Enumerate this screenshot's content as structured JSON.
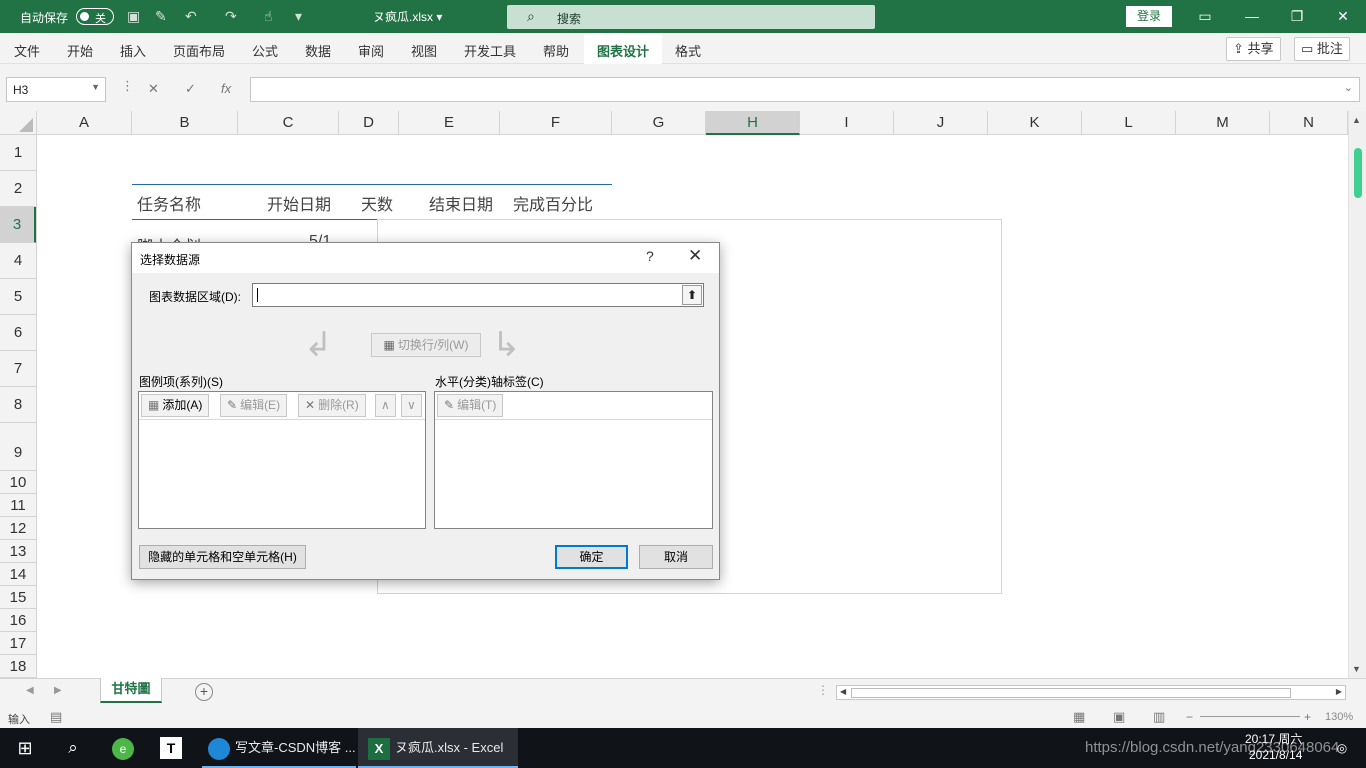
{
  "titlebar": {
    "autosave_label": "自动保存",
    "autosave_state": "关",
    "document_name": "ヌ疯瓜.xlsx",
    "search_placeholder": "搜索",
    "login_label": "登录"
  },
  "ribbon": {
    "tabs": [
      "文件",
      "开始",
      "插入",
      "页面布局",
      "公式",
      "数据",
      "审阅",
      "视图",
      "开发工具",
      "帮助",
      "图表设计",
      "格式"
    ],
    "active_tab": "图表设计",
    "share_label": "共享",
    "comments_label": "批注"
  },
  "formula_bar": {
    "name_box": "H3",
    "cancel_icon": "✕",
    "enter_icon": "✓",
    "fx_label": "fx",
    "formula": ""
  },
  "grid": {
    "columns": [
      "A",
      "B",
      "C",
      "D",
      "E",
      "F",
      "G",
      "H",
      "I",
      "J",
      "K",
      "L",
      "M",
      "N"
    ],
    "selected_column": "H",
    "rows": [
      "1",
      "2",
      "3",
      "4",
      "5",
      "6",
      "7",
      "8",
      "9",
      "10",
      "11",
      "12",
      "13",
      "14",
      "15",
      "16",
      "17",
      "18"
    ],
    "selected_row": "3",
    "header_row": {
      "task": "任务名称",
      "start": "开始日期",
      "days": "天数",
      "end": "结束日期",
      "percent": "完成百分比"
    },
    "row3_partial_b": "脚本企划",
    "row3_partial_c": "5/1"
  },
  "dialog": {
    "title": "选择数据源",
    "help": "?",
    "close": "✕",
    "chart_range_label": "图表数据区域(D):",
    "chart_range_value": "",
    "switch_button": "切换行/列(W)",
    "legend_label": "图例项(系列)(S)",
    "add_button": "添加(A)",
    "edit_button": "编辑(E)",
    "delete_button": "删除(R)",
    "axis_label": "水平(分类)轴标签(C)",
    "axis_edit_button": "编辑(T)",
    "hidden_cells_button": "隐藏的单元格和空单元格(H)",
    "ok_button": "确定",
    "cancel_button": "取消"
  },
  "sheet_tabs": {
    "active": "甘特圖",
    "add_label": "+"
  },
  "statusbar": {
    "mode": "输入",
    "zoom": "130%"
  },
  "taskbar": {
    "apps": [
      {
        "label": "写文章-CSDN博客 ..."
      },
      {
        "label": "ヌ疯瓜.xlsx - Excel"
      }
    ],
    "time": "20:17 周六",
    "date": "2021/8/14",
    "watermark": "https://blog.csdn.net/yang2330648064"
  }
}
